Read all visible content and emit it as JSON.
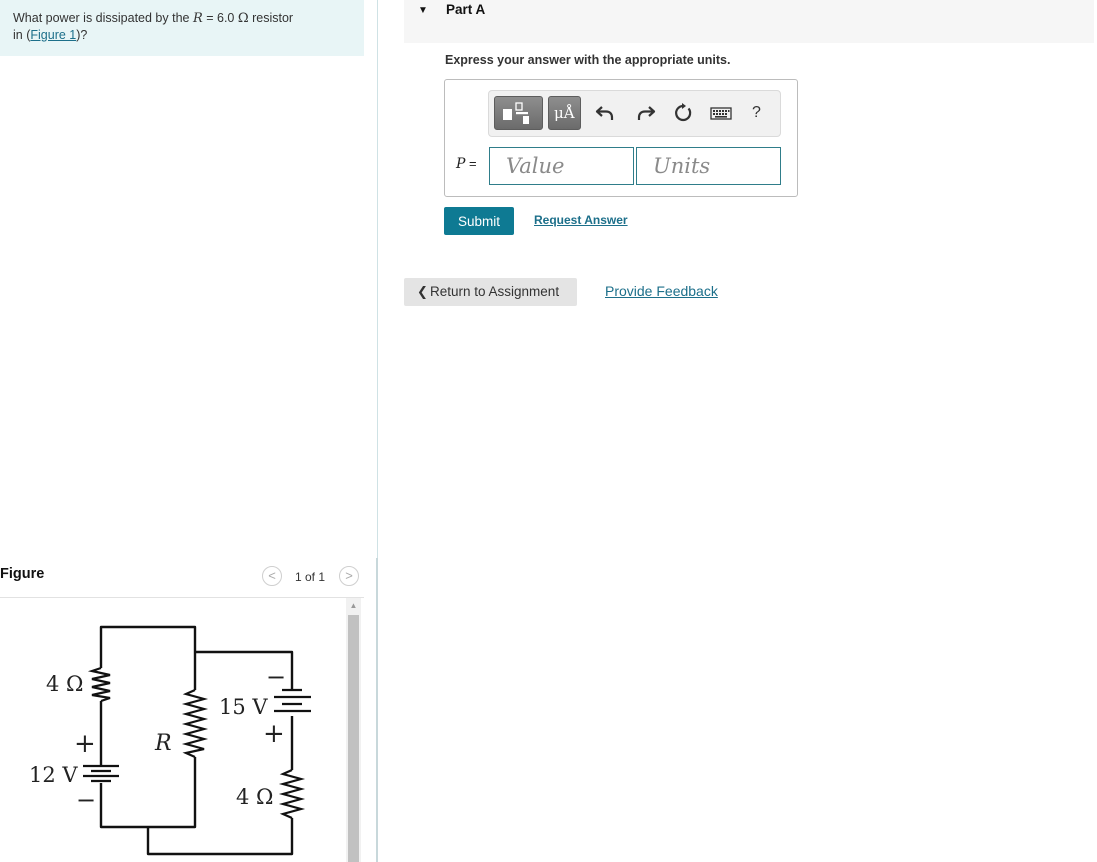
{
  "question": {
    "text_before": "What power is dissipated by the ",
    "variable": "R",
    "value_text": " = 6.0 ",
    "unit_symbol": "Ω",
    "text_after": " resistor",
    "line2_prefix": "in (",
    "figure_link": "Figure 1",
    "line2_suffix": ")?"
  },
  "figure_panel": {
    "title": "Figure",
    "prev_symbol": "<",
    "next_symbol": ">",
    "counter": "1 of 1"
  },
  "circuit": {
    "resistor_top_left": "4 Ω",
    "battery_left": "12 V",
    "resistor_middle": "R",
    "battery_right": "15 V",
    "resistor_bottom_right": "4 Ω",
    "plus": "+",
    "minus": "−"
  },
  "part": {
    "caret": "▼",
    "title": "Part A",
    "instruction": "Express your answer with the appropriate units."
  },
  "toolbar": {
    "units_button": "μÅ",
    "help": "?"
  },
  "answer": {
    "variable": "P",
    "equals": " =",
    "value_placeholder": "Value",
    "units_placeholder": "Units"
  },
  "actions": {
    "submit": "Submit",
    "request_answer": "Request Answer",
    "return_chevron": "❮",
    "return_label": "Return to Assignment",
    "feedback": "Provide Feedback"
  },
  "colors": {
    "question_bg": "#e8f5f6",
    "accent": "#0e7a93",
    "link": "#1c6f8a"
  }
}
